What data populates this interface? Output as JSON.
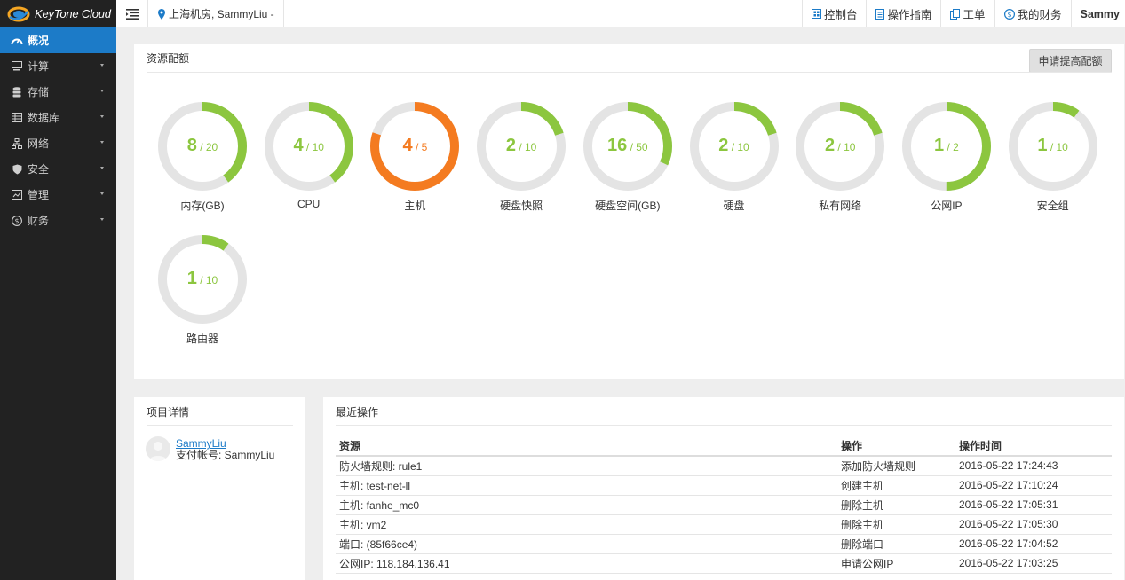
{
  "brand": {
    "name": "KeyTone Cloud"
  },
  "header": {
    "region": "上海机房, SammyLiu -",
    "nav": [
      {
        "label": "控制台",
        "icon": "dashboard-icon"
      },
      {
        "label": "操作指南",
        "icon": "guide-icon"
      },
      {
        "label": "工单",
        "icon": "ticket-icon"
      },
      {
        "label": "我的财务",
        "icon": "finance-icon"
      }
    ],
    "user": "Sammy"
  },
  "sidebar": {
    "items": [
      {
        "label": "概况",
        "icon": "gauge-icon",
        "active": true
      },
      {
        "label": "计算",
        "icon": "monitor-icon"
      },
      {
        "label": "存储",
        "icon": "database-icon"
      },
      {
        "label": "数据库",
        "icon": "table-icon"
      },
      {
        "label": "网络",
        "icon": "network-icon"
      },
      {
        "label": "安全",
        "icon": "shield-icon"
      },
      {
        "label": "管理",
        "icon": "manage-icon"
      },
      {
        "label": "财务",
        "icon": "dollar-icon"
      }
    ]
  },
  "quota": {
    "title": "资源配额",
    "apply_label": "申请提高配额",
    "colors": {
      "normal": "#8cc63f",
      "warning": "#f47b20",
      "track": "#e4e4e4"
    },
    "gauges": [
      {
        "used": "8",
        "total": "/ 20",
        "label": "内存(GB)",
        "ratio": 0.4,
        "status": "normal"
      },
      {
        "used": "4",
        "total": "/ 10",
        "label": "CPU",
        "ratio": 0.4,
        "status": "normal"
      },
      {
        "used": "4",
        "total": "/ 5",
        "label": "主机",
        "ratio": 0.8,
        "status": "warning"
      },
      {
        "used": "2",
        "total": "/ 10",
        "label": "硬盘快照",
        "ratio": 0.2,
        "status": "normal"
      },
      {
        "used": "16",
        "total": "/ 50",
        "label": "硬盘空间(GB)",
        "ratio": 0.32,
        "status": "normal"
      },
      {
        "used": "2",
        "total": "/ 10",
        "label": "硬盘",
        "ratio": 0.2,
        "status": "normal"
      },
      {
        "used": "2",
        "total": "/ 10",
        "label": "私有网络",
        "ratio": 0.2,
        "status": "normal"
      },
      {
        "used": "1",
        "total": "/ 2",
        "label": "公网IP",
        "ratio": 0.5,
        "status": "normal"
      },
      {
        "used": "1",
        "total": "/ 10",
        "label": "安全组",
        "ratio": 0.1,
        "status": "normal"
      },
      {
        "used": "1",
        "total": "/ 10",
        "label": "路由器",
        "ratio": 0.1,
        "status": "normal"
      }
    ]
  },
  "project": {
    "title": "项目详情",
    "user_name": "SammyLiu",
    "account": "支付帐号: SammyLiu"
  },
  "operations": {
    "title": "最近操作",
    "columns": [
      "资源",
      "操作",
      "操作时间"
    ],
    "rows": [
      [
        "防火墙规则: rule1",
        "添加防火墙规则",
        "2016-05-22 17:24:43"
      ],
      [
        "主机: test-net-ll",
        "创建主机",
        "2016-05-22 17:10:24"
      ],
      [
        "主机: fanhe_mc0",
        "删除主机",
        "2016-05-22 17:05:31"
      ],
      [
        "主机: vm2",
        "删除主机",
        "2016-05-22 17:05:30"
      ],
      [
        "端口: (85f66ce4)",
        "删除端口",
        "2016-05-22 17:04:52"
      ],
      [
        "公网IP: 118.184.136.41",
        "申请公网IP",
        "2016-05-22 17:03:25"
      ]
    ]
  }
}
